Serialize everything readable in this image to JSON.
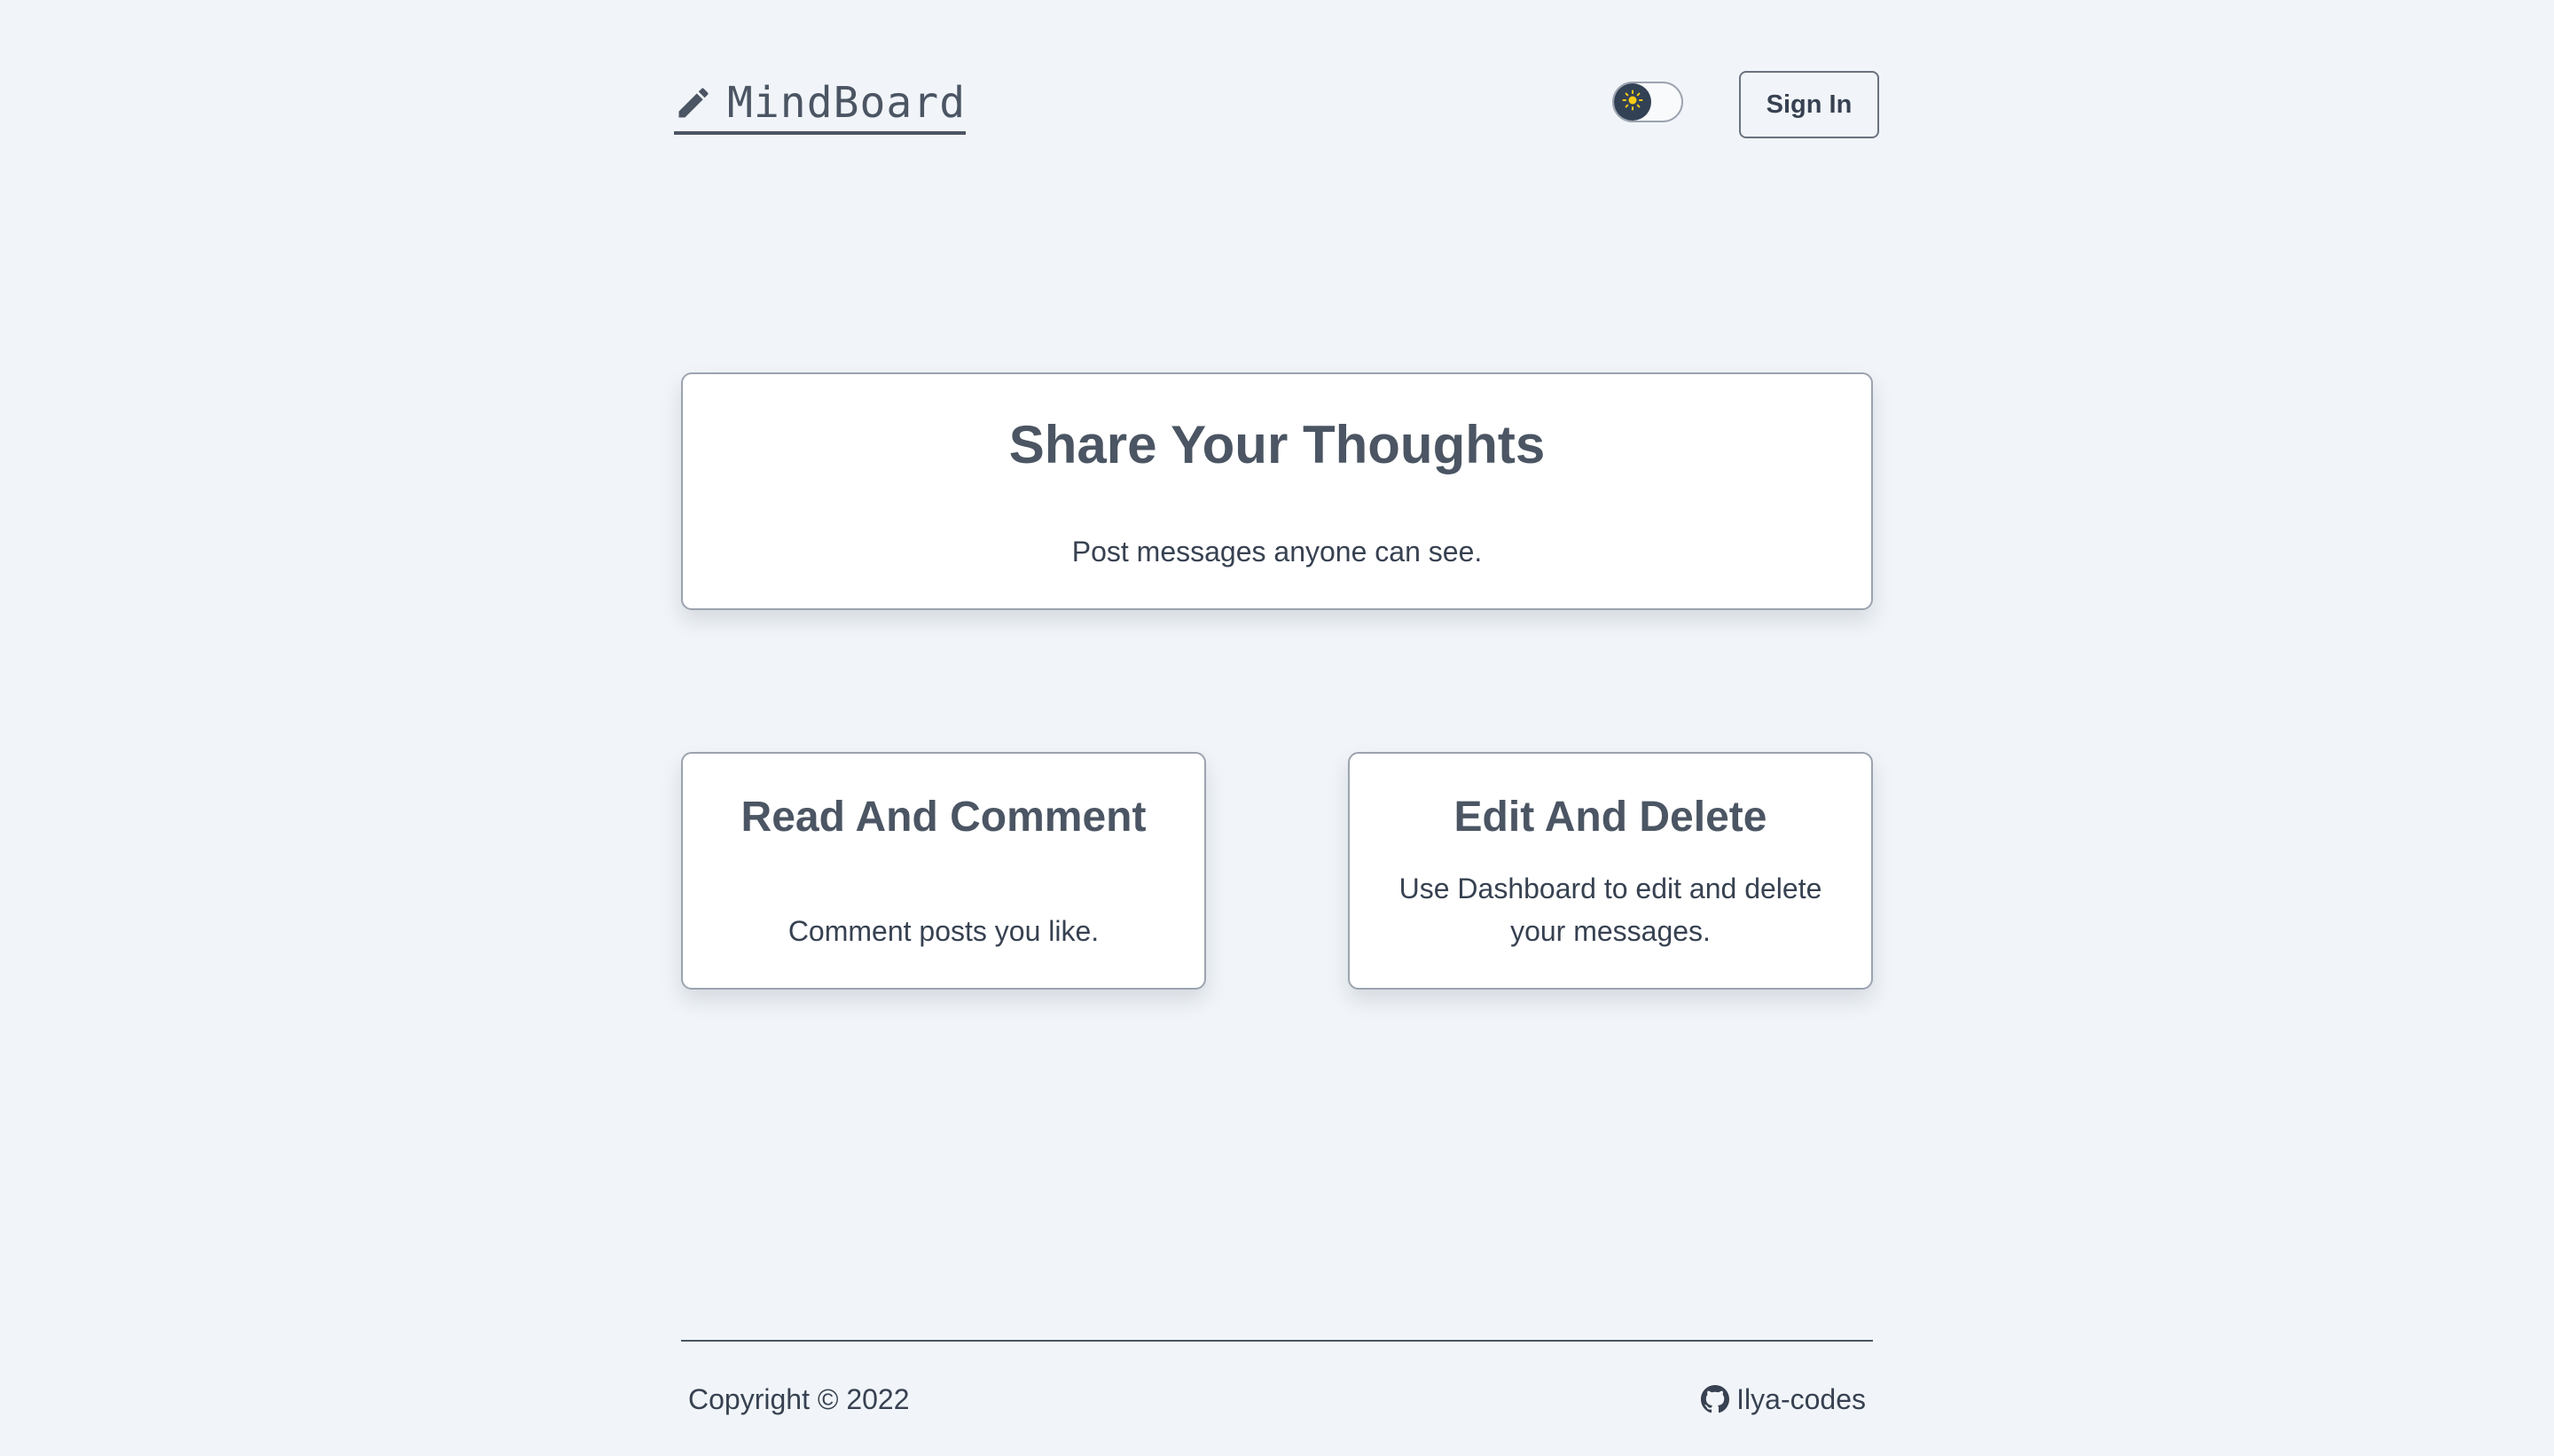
{
  "header": {
    "logo_text": "MindBoard",
    "logo_icon": "pencil-icon",
    "theme_toggle_icon": "sun-icon",
    "sign_in_label": "Sign In"
  },
  "hero": {
    "title": "Share Your Thoughts",
    "description": "Post messages anyone can see."
  },
  "features": [
    {
      "title": "Read And Comment",
      "description": "Comment posts you like."
    },
    {
      "title": "Edit And Delete",
      "description": "Use Dashboard to edit and delete your messages."
    }
  ],
  "footer": {
    "copyright": "Copyright © 2022",
    "github_icon": "github-icon",
    "github_label": "Ilya-codes"
  },
  "colors": {
    "background": "#f1f5f9",
    "card_background": "#ffffff",
    "card_border": "#9ca3af",
    "text_primary": "#4b5563",
    "toggle_knob": "#334155",
    "sun": "#facc15"
  }
}
